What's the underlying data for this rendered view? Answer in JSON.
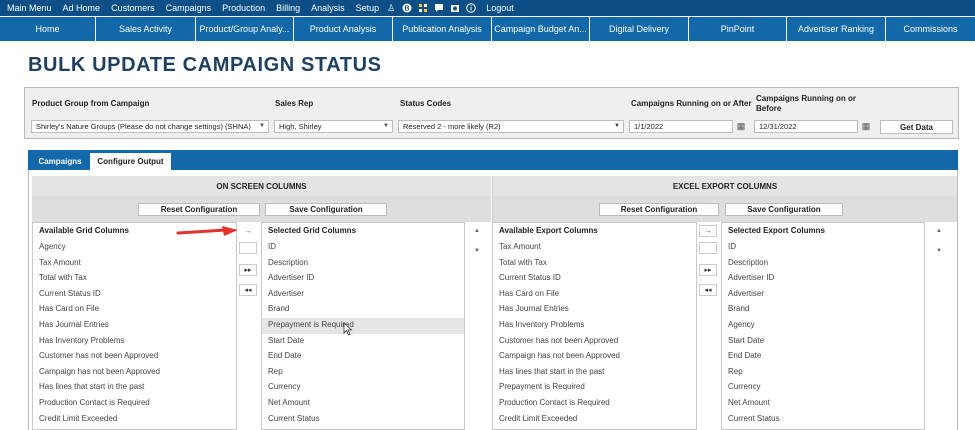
{
  "topbar": {
    "items": [
      "Main Menu",
      "Ad Home",
      "Customers",
      "Campaigns",
      "Production",
      "Billing",
      "Analysis",
      "Setup"
    ],
    "icons": [
      "person-run-icon",
      "bitcoin-icon",
      "grid-icon",
      "chat-icon",
      "camera-icon",
      "info-icon"
    ],
    "logout": "Logout"
  },
  "nav": {
    "tabs": [
      "Home",
      "Sales Activity",
      "Product/Group Analy...",
      "Product Analysis",
      "Publication Analysis",
      "Campaign Budget An...",
      "Digital Delivery",
      "PinPoint",
      "Advertiser Ranking",
      "Commissions"
    ]
  },
  "page_title": "BULK UPDATE CAMPAIGN STATUS",
  "filters": {
    "product_group_label": "Product Group from Campaign",
    "product_group_value": "Shirley's Nature Groups (Please do not change settings) (SHNA)",
    "sales_rep_label": "Sales Rep",
    "sales_rep_value": "High, Shirley",
    "status_codes_label": "Status Codes",
    "status_codes_value": "Reserved 2 - more likely (R2)",
    "after_label": "Campaigns Running on or After",
    "after_value": "1/1/2022",
    "before_label_1": "Campaigns Running on or",
    "before_label_2": "Before",
    "before_value": "12/31/2022",
    "get_data": "Get Data"
  },
  "tabs": {
    "campaigns": "Campaigns",
    "configure_output": "Configure Output"
  },
  "on_screen": {
    "heading": "ON SCREEN COLUMNS",
    "reset": "Reset Configuration",
    "save": "Save Configuration",
    "available_header": "Available Grid Columns",
    "available": [
      "Agency",
      "Tax Amount",
      "Total with Tax",
      "Current Status ID",
      "Has Card on File",
      "Has Journal Entries",
      "Has Inventory Problems",
      "Customer has not been Approved",
      "Campaign has not been Approved",
      "Has lines that start in the past",
      "Production Contact is Required",
      "Credit Limit Exceeded"
    ],
    "selected_header": "Selected Grid Columns",
    "selected": [
      "ID",
      "Description",
      "Advertiser ID",
      "Advertiser",
      "Brand",
      "Prepayment is Required",
      "Start Date",
      "End Date",
      "Rep",
      "Currency",
      "Net Amount",
      "Current Status"
    ],
    "highlighted": "Prepayment is Required"
  },
  "excel": {
    "heading": "EXCEL EXPORT COLUMNS",
    "reset": "Reset Configuration",
    "save": "Save Configuration",
    "available_header": "Available Export Columns",
    "available": [
      "Tax Amount",
      "Total with Tax",
      "Current Status ID",
      "Has Card on File",
      "Has Journal Entries",
      "Has Inventory Problems",
      "Customer has not been Approved",
      "Campaign has not been Approved",
      "Has lines that start in the past",
      "Prepayment is Required",
      "Production Contact is Required",
      "Credit Limit Exceeded"
    ],
    "selected_header": "Selected Export Columns",
    "selected": [
      "ID",
      "Description",
      "Advertiser ID",
      "Advertiser",
      "Brand",
      "Agency",
      "Start Date",
      "End Date",
      "Rep",
      "Currency",
      "Net Amount",
      "Current Status"
    ]
  },
  "mover": {
    "move_right": "→",
    "move_all_right": "▸▸",
    "move_all_left": "◂◂",
    "up": "▲",
    "down": "▼"
  },
  "colors": {
    "topbar": "#0b4f86",
    "navbar": "#1268a8",
    "title": "#1f4060",
    "annotation_arrow": "#e0332c"
  }
}
